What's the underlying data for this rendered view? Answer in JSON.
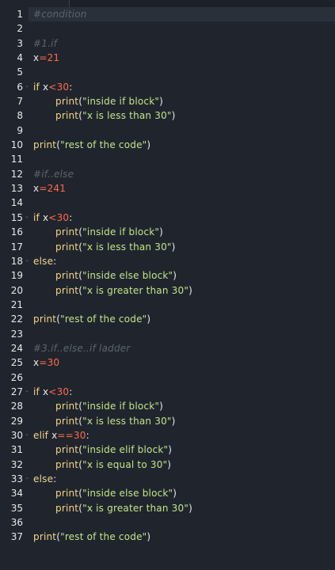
{
  "editor": {
    "lines": [
      {
        "n": "1",
        "fold": "",
        "indent": false,
        "tokens": [
          {
            "t": "comment",
            "v": "#condition"
          }
        ]
      },
      {
        "n": "2",
        "fold": "",
        "indent": false,
        "tokens": []
      },
      {
        "n": "3",
        "fold": "",
        "indent": false,
        "tokens": [
          {
            "t": "comment",
            "v": "#1.if"
          }
        ]
      },
      {
        "n": "4",
        "fold": "",
        "indent": false,
        "tokens": [
          {
            "t": "var",
            "v": "x"
          },
          {
            "t": "op",
            "v": "="
          },
          {
            "t": "num",
            "v": "21"
          }
        ]
      },
      {
        "n": "5",
        "fold": "",
        "indent": false,
        "tokens": []
      },
      {
        "n": "6",
        "fold": "-",
        "indent": false,
        "tokens": [
          {
            "t": "kw",
            "v": "if"
          },
          {
            "t": "var",
            "v": " x"
          },
          {
            "t": "op",
            "v": "<"
          },
          {
            "t": "num",
            "v": "30"
          },
          {
            "t": "punc",
            "v": ":"
          }
        ]
      },
      {
        "n": "7",
        "fold": "",
        "indent": true,
        "tokens": [
          {
            "t": "fn",
            "v": "print"
          },
          {
            "t": "punc",
            "v": "("
          },
          {
            "t": "str",
            "v": "\"inside if block\""
          },
          {
            "t": "punc",
            "v": ")"
          }
        ]
      },
      {
        "n": "8",
        "fold": "",
        "indent": true,
        "tokens": [
          {
            "t": "fn",
            "v": "print"
          },
          {
            "t": "punc",
            "v": "("
          },
          {
            "t": "str",
            "v": "\"x is less than 30\""
          },
          {
            "t": "punc",
            "v": ")"
          }
        ]
      },
      {
        "n": "9",
        "fold": "",
        "indent": false,
        "tokens": []
      },
      {
        "n": "10",
        "fold": "",
        "indent": false,
        "tokens": [
          {
            "t": "fn",
            "v": "print"
          },
          {
            "t": "punc",
            "v": "("
          },
          {
            "t": "str",
            "v": "\"rest of the code\""
          },
          {
            "t": "punc",
            "v": ")"
          }
        ]
      },
      {
        "n": "11",
        "fold": "",
        "indent": false,
        "tokens": []
      },
      {
        "n": "12",
        "fold": "",
        "indent": false,
        "tokens": [
          {
            "t": "comment",
            "v": "#if..else"
          }
        ]
      },
      {
        "n": "13",
        "fold": "",
        "indent": false,
        "tokens": [
          {
            "t": "var",
            "v": "x"
          },
          {
            "t": "op",
            "v": "="
          },
          {
            "t": "num",
            "v": "241"
          }
        ]
      },
      {
        "n": "14",
        "fold": "",
        "indent": false,
        "tokens": []
      },
      {
        "n": "15",
        "fold": "-",
        "indent": false,
        "tokens": [
          {
            "t": "kw",
            "v": "if"
          },
          {
            "t": "var",
            "v": " x"
          },
          {
            "t": "op",
            "v": "<"
          },
          {
            "t": "num",
            "v": "30"
          },
          {
            "t": "punc",
            "v": ":"
          }
        ]
      },
      {
        "n": "16",
        "fold": "",
        "indent": true,
        "tokens": [
          {
            "t": "fn",
            "v": "print"
          },
          {
            "t": "punc",
            "v": "("
          },
          {
            "t": "str",
            "v": "\"inside if block\""
          },
          {
            "t": "punc",
            "v": ")"
          }
        ]
      },
      {
        "n": "17",
        "fold": "",
        "indent": true,
        "tokens": [
          {
            "t": "fn",
            "v": "print"
          },
          {
            "t": "punc",
            "v": "("
          },
          {
            "t": "str",
            "v": "\"x is less than 30\""
          },
          {
            "t": "punc",
            "v": ")"
          }
        ]
      },
      {
        "n": "18",
        "fold": "-",
        "indent": false,
        "tokens": [
          {
            "t": "kw",
            "v": "else"
          },
          {
            "t": "punc",
            "v": ":"
          }
        ]
      },
      {
        "n": "19",
        "fold": "",
        "indent": true,
        "tokens": [
          {
            "t": "fn",
            "v": "print"
          },
          {
            "t": "punc",
            "v": "("
          },
          {
            "t": "str",
            "v": "\"inside else block\""
          },
          {
            "t": "punc",
            "v": ")"
          }
        ]
      },
      {
        "n": "20",
        "fold": "",
        "indent": true,
        "tokens": [
          {
            "t": "fn",
            "v": "print"
          },
          {
            "t": "punc",
            "v": "("
          },
          {
            "t": "str",
            "v": "\"x is greater than 30\""
          },
          {
            "t": "punc",
            "v": ")"
          }
        ]
      },
      {
        "n": "21",
        "fold": "",
        "indent": false,
        "tokens": []
      },
      {
        "n": "22",
        "fold": "",
        "indent": false,
        "tokens": [
          {
            "t": "fn",
            "v": "print"
          },
          {
            "t": "punc",
            "v": "("
          },
          {
            "t": "str",
            "v": "\"rest of the code\""
          },
          {
            "t": "punc",
            "v": ")"
          }
        ]
      },
      {
        "n": "23",
        "fold": "",
        "indent": false,
        "tokens": []
      },
      {
        "n": "24",
        "fold": "",
        "indent": false,
        "tokens": [
          {
            "t": "comment",
            "v": "#3.if..else..if ladder"
          }
        ]
      },
      {
        "n": "25",
        "fold": "",
        "indent": false,
        "tokens": [
          {
            "t": "var",
            "v": "x"
          },
          {
            "t": "op",
            "v": "="
          },
          {
            "t": "num",
            "v": "30"
          }
        ]
      },
      {
        "n": "26",
        "fold": "",
        "indent": false,
        "tokens": []
      },
      {
        "n": "27",
        "fold": "-",
        "indent": false,
        "tokens": [
          {
            "t": "kw",
            "v": "if"
          },
          {
            "t": "var",
            "v": " x"
          },
          {
            "t": "op",
            "v": "<"
          },
          {
            "t": "num",
            "v": "30"
          },
          {
            "t": "punc",
            "v": ":"
          }
        ]
      },
      {
        "n": "28",
        "fold": "",
        "indent": true,
        "tokens": [
          {
            "t": "fn",
            "v": "print"
          },
          {
            "t": "punc",
            "v": "("
          },
          {
            "t": "str",
            "v": "\"inside if block\""
          },
          {
            "t": "punc",
            "v": ")"
          }
        ]
      },
      {
        "n": "29",
        "fold": "",
        "indent": true,
        "tokens": [
          {
            "t": "fn",
            "v": "print"
          },
          {
            "t": "punc",
            "v": "("
          },
          {
            "t": "str",
            "v": "\"x is less than 30\""
          },
          {
            "t": "punc",
            "v": ")"
          }
        ]
      },
      {
        "n": "30",
        "fold": "-",
        "indent": false,
        "tokens": [
          {
            "t": "kw",
            "v": "elif"
          },
          {
            "t": "var",
            "v": " x"
          },
          {
            "t": "op",
            "v": "=="
          },
          {
            "t": "num",
            "v": "30"
          },
          {
            "t": "punc",
            "v": ":"
          }
        ]
      },
      {
        "n": "31",
        "fold": "",
        "indent": true,
        "tokens": [
          {
            "t": "fn",
            "v": "print"
          },
          {
            "t": "punc",
            "v": "("
          },
          {
            "t": "str",
            "v": "\"inside elif block\""
          },
          {
            "t": "punc",
            "v": ")"
          }
        ]
      },
      {
        "n": "32",
        "fold": "",
        "indent": true,
        "tokens": [
          {
            "t": "fn",
            "v": "print"
          },
          {
            "t": "punc",
            "v": "("
          },
          {
            "t": "str",
            "v": "\"x is equal to 30\""
          },
          {
            "t": "punc",
            "v": ")"
          }
        ]
      },
      {
        "n": "33",
        "fold": "-",
        "indent": false,
        "tokens": [
          {
            "t": "kw",
            "v": "else"
          },
          {
            "t": "punc",
            "v": ":"
          }
        ]
      },
      {
        "n": "34",
        "fold": "",
        "indent": true,
        "tokens": [
          {
            "t": "fn",
            "v": "print"
          },
          {
            "t": "punc",
            "v": "("
          },
          {
            "t": "str",
            "v": "\"inside else block\""
          },
          {
            "t": "punc",
            "v": ")"
          }
        ]
      },
      {
        "n": "35",
        "fold": "",
        "indent": true,
        "tokens": [
          {
            "t": "fn",
            "v": "print"
          },
          {
            "t": "punc",
            "v": "("
          },
          {
            "t": "str",
            "v": "\"x is greater than 30\""
          },
          {
            "t": "punc",
            "v": ")"
          }
        ]
      },
      {
        "n": "36",
        "fold": "",
        "indent": false,
        "tokens": []
      },
      {
        "n": "37",
        "fold": "",
        "indent": false,
        "tokens": [
          {
            "t": "fn",
            "v": "print"
          },
          {
            "t": "punc",
            "v": "("
          },
          {
            "t": "str",
            "v": "\"rest of the code\""
          },
          {
            "t": "punc",
            "v": ")"
          }
        ]
      }
    ]
  },
  "colors": {
    "background": "#20252d",
    "comment": "#5d646e",
    "keyword": "#f5d58a",
    "number": "#ff6a4a",
    "string": "#c2e58b"
  }
}
